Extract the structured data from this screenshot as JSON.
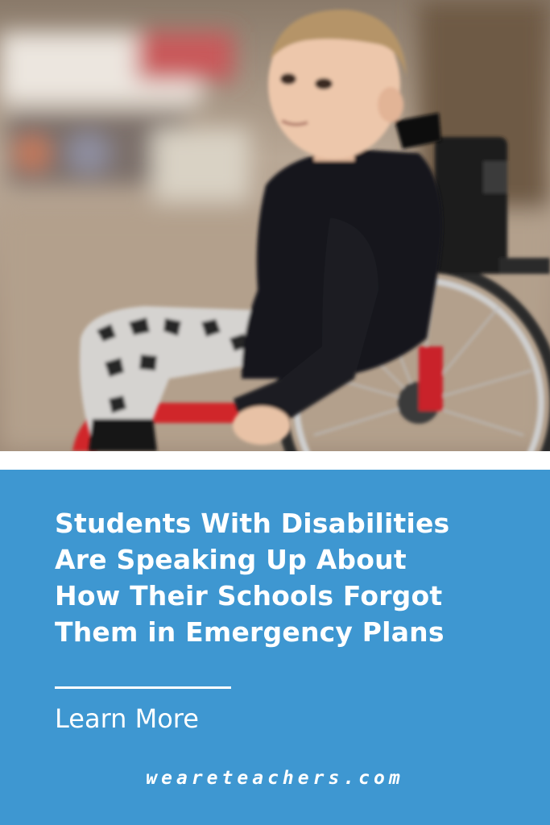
{
  "photo": {
    "description_icon": "child-in-wheelchair-photo"
  },
  "panel": {
    "background": "#3e97d1",
    "headline": "Students With Disabilities\nAre Speaking Up About\nHow Their Schools Forgot\nThem in Emergency Plans",
    "cta_label": "Learn More",
    "site_label": "weareteachers.com"
  },
  "colors": {
    "panel_blue": "#3e97d1",
    "text": "#ffffff"
  }
}
